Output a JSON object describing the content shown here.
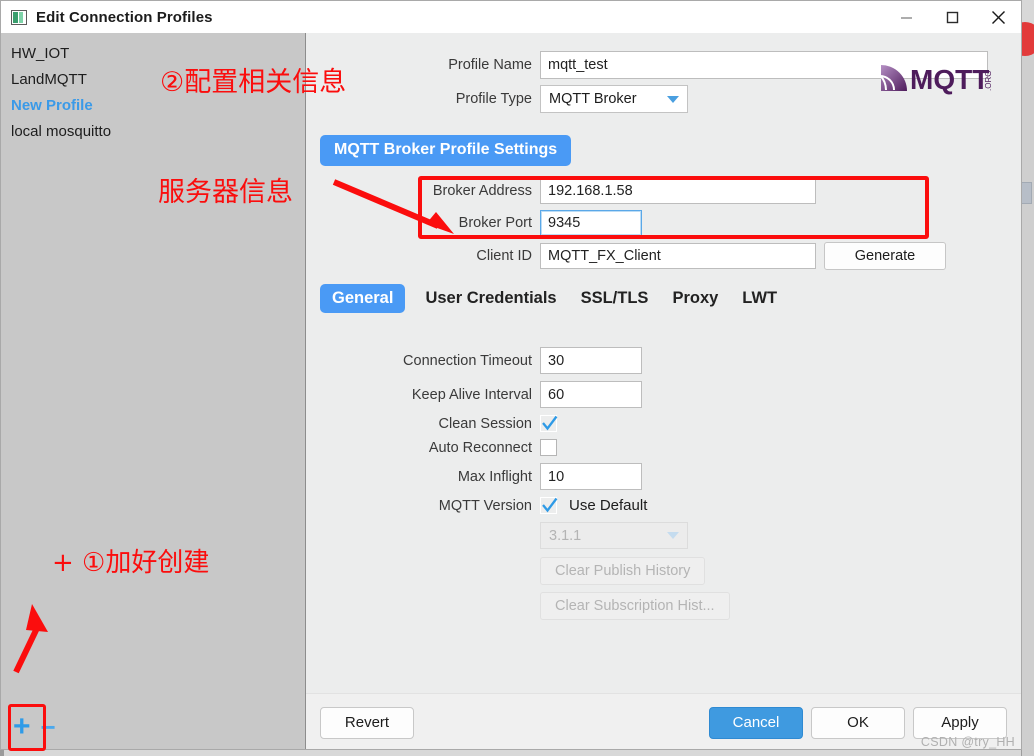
{
  "window": {
    "title": "Edit Connection Profiles",
    "app_icon": "app-window-icon",
    "minimize_label": "—",
    "maximize_label": "□",
    "close_label": "×"
  },
  "sidebar": {
    "profiles": [
      {
        "label": "HW_IOT",
        "selected": false
      },
      {
        "label": "LandMQTT",
        "selected": false
      },
      {
        "label": "New Profile",
        "selected": true
      },
      {
        "label": "local mosquitto",
        "selected": false
      }
    ],
    "add_button_label": "+",
    "remove_button_label": "−"
  },
  "form": {
    "profile_name_label": "Profile Name",
    "profile_name_value": "mqtt_test",
    "profile_type_label": "Profile Type",
    "profile_type_value": "MQTT Broker",
    "profile_type_options": [
      "MQTT Broker"
    ],
    "logo_alt": "MQTT.org",
    "logo_text": "MQTT",
    "logo_suffix": ".ORG",
    "section_title": "MQTT Broker Profile Settings",
    "broker_address_label": "Broker Address",
    "broker_address_value": "192.168.1.58",
    "broker_port_label": "Broker Port",
    "broker_port_value": "9345",
    "client_id_label": "Client ID",
    "client_id_value": "MQTT_FX_Client",
    "generate_label": "Generate"
  },
  "tabs": [
    {
      "label": "General",
      "active": true
    },
    {
      "label": "User Credentials",
      "active": false
    },
    {
      "label": "SSL/TLS",
      "active": false
    },
    {
      "label": "Proxy",
      "active": false
    },
    {
      "label": "LWT",
      "active": false
    }
  ],
  "general": {
    "connection_timeout_label": "Connection Timeout",
    "connection_timeout_value": "30",
    "keep_alive_label": "Keep Alive Interval",
    "keep_alive_value": "60",
    "clean_session_label": "Clean Session",
    "clean_session_checked": true,
    "auto_reconnect_label": "Auto Reconnect",
    "auto_reconnect_checked": false,
    "max_inflight_label": "Max Inflight",
    "max_inflight_value": "10",
    "mqtt_version_label": "MQTT Version",
    "use_default_label": "Use Default",
    "use_default_checked": true,
    "version_value": "3.1.1",
    "clear_publish_history_label": "Clear Publish History",
    "clear_subscription_history_label": "Clear Subscription Hist..."
  },
  "footer": {
    "revert_label": "Revert",
    "cancel_label": "Cancel",
    "ok_label": "OK",
    "apply_label": "Apply",
    "watermark": "CSDN @try_HH"
  },
  "annotations": {
    "config_info": "②配置相关信息",
    "server_info": "服务器信息",
    "create_profile": "+ ①加好创建"
  },
  "colors": {
    "accent_blue": "#4a9af5",
    "annotation_red": "#fb0d0d",
    "sidebar_bg": "#c8c8c8",
    "panel_bg": "#eceded",
    "selected_profile": "#3a9ae8"
  }
}
